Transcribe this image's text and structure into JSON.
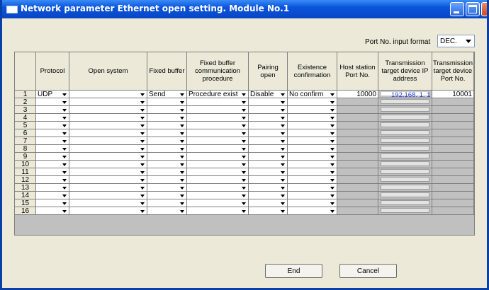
{
  "window": {
    "title": "Network parameter Ethernet open setting. Module No.1"
  },
  "port_format": {
    "label": "Port No. input format",
    "value": "DEC."
  },
  "table": {
    "headers": {
      "protocol": "Protocol",
      "open_system": "Open system",
      "fixed_buffer": "Fixed buffer",
      "fb_procedure": "Fixed buffer communication procedure",
      "pairing_open": "Pairing open",
      "existence": "Existence confirmation",
      "host_port": "Host station Port No.",
      "target_ip": "Transmission target device IP address",
      "target_port": "Transmission target device Port No."
    },
    "rows": [
      {
        "no": "1",
        "protocol": "UDP",
        "open_system": "",
        "fixed_buffer": "Send",
        "fb_procedure": "Procedure exist",
        "pairing_open": "Disable",
        "existence": "No confirm",
        "host_port": "10000",
        "target_ip": "192.168.  1.  1",
        "target_port": "10001"
      },
      {
        "no": "2",
        "protocol": "",
        "open_system": "",
        "fixed_buffer": "",
        "fb_procedure": "",
        "pairing_open": "",
        "existence": "",
        "host_port": "",
        "target_ip": "",
        "target_port": ""
      },
      {
        "no": "3",
        "protocol": "",
        "open_system": "",
        "fixed_buffer": "",
        "fb_procedure": "",
        "pairing_open": "",
        "existence": "",
        "host_port": "",
        "target_ip": "",
        "target_port": ""
      },
      {
        "no": "4",
        "protocol": "",
        "open_system": "",
        "fixed_buffer": "",
        "fb_procedure": "",
        "pairing_open": "",
        "existence": "",
        "host_port": "",
        "target_ip": "",
        "target_port": ""
      },
      {
        "no": "5",
        "protocol": "",
        "open_system": "",
        "fixed_buffer": "",
        "fb_procedure": "",
        "pairing_open": "",
        "existence": "",
        "host_port": "",
        "target_ip": "",
        "target_port": ""
      },
      {
        "no": "6",
        "protocol": "",
        "open_system": "",
        "fixed_buffer": "",
        "fb_procedure": "",
        "pairing_open": "",
        "existence": "",
        "host_port": "",
        "target_ip": "",
        "target_port": ""
      },
      {
        "no": "7",
        "protocol": "",
        "open_system": "",
        "fixed_buffer": "",
        "fb_procedure": "",
        "pairing_open": "",
        "existence": "",
        "host_port": "",
        "target_ip": "",
        "target_port": ""
      },
      {
        "no": "8",
        "protocol": "",
        "open_system": "",
        "fixed_buffer": "",
        "fb_procedure": "",
        "pairing_open": "",
        "existence": "",
        "host_port": "",
        "target_ip": "",
        "target_port": ""
      },
      {
        "no": "9",
        "protocol": "",
        "open_system": "",
        "fixed_buffer": "",
        "fb_procedure": "",
        "pairing_open": "",
        "existence": "",
        "host_port": "",
        "target_ip": "",
        "target_port": ""
      },
      {
        "no": "10",
        "protocol": "",
        "open_system": "",
        "fixed_buffer": "",
        "fb_procedure": "",
        "pairing_open": "",
        "existence": "",
        "host_port": "",
        "target_ip": "",
        "target_port": ""
      },
      {
        "no": "11",
        "protocol": "",
        "open_system": "",
        "fixed_buffer": "",
        "fb_procedure": "",
        "pairing_open": "",
        "existence": "",
        "host_port": "",
        "target_ip": "",
        "target_port": ""
      },
      {
        "no": "12",
        "protocol": "",
        "open_system": "",
        "fixed_buffer": "",
        "fb_procedure": "",
        "pairing_open": "",
        "existence": "",
        "host_port": "",
        "target_ip": "",
        "target_port": ""
      },
      {
        "no": "13",
        "protocol": "",
        "open_system": "",
        "fixed_buffer": "",
        "fb_procedure": "",
        "pairing_open": "",
        "existence": "",
        "host_port": "",
        "target_ip": "",
        "target_port": ""
      },
      {
        "no": "14",
        "protocol": "",
        "open_system": "",
        "fixed_buffer": "",
        "fb_procedure": "",
        "pairing_open": "",
        "existence": "",
        "host_port": "",
        "target_ip": "",
        "target_port": ""
      },
      {
        "no": "15",
        "protocol": "",
        "open_system": "",
        "fixed_buffer": "",
        "fb_procedure": "",
        "pairing_open": "",
        "existence": "",
        "host_port": "",
        "target_ip": "",
        "target_port": ""
      },
      {
        "no": "16",
        "protocol": "",
        "open_system": "",
        "fixed_buffer": "",
        "fb_procedure": "",
        "pairing_open": "",
        "existence": "",
        "host_port": "",
        "target_ip": "",
        "target_port": ""
      }
    ]
  },
  "buttons": {
    "end": "End",
    "cancel": "Cancel"
  }
}
